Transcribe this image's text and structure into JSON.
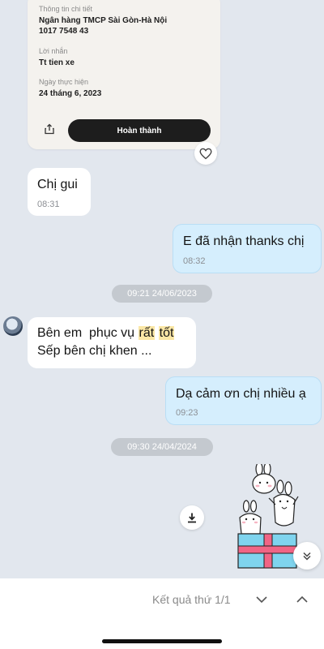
{
  "receipt": {
    "section_label": "Thông tin chi tiết",
    "bank_name": "Ngân hàng TMCP Sài Gòn-Hà Nội",
    "account_number": "1017 7548 43",
    "message_label": "Lời nhắn",
    "message_value": "Tt tien xe",
    "date_label": "Ngày thực hiện",
    "date_value": "24 tháng 6, 2023",
    "done_button": "Hoàn thành",
    "share_icon": "share-icon",
    "heart_icon": "heart-icon"
  },
  "messages": [
    {
      "direction": "incoming",
      "text": "Chị gui",
      "time": "08:31"
    },
    {
      "direction": "outgoing",
      "text": "E đã nhận thanks chị",
      "time": "08:32"
    },
    {
      "direction": "incoming",
      "line1_prefix": "Bên em  phục vụ ",
      "highlight1": "rất",
      "space": " ",
      "highlight2": "tốt",
      "line2": "Sếp bên chị khen ..."
    },
    {
      "direction": "outgoing",
      "text": "Dạ cảm ơn chị nhiều ạ",
      "time": "09:23"
    }
  ],
  "date_separators": [
    "09:21 24/06/2023",
    "09:30 24/04/2024"
  ],
  "sticker": {
    "name": "bunny-gift-sticker"
  },
  "search_bar": {
    "result_text": "Kết quả thứ 1/1",
    "prev_icon": "chevron-down-icon",
    "next_icon": "chevron-up-icon"
  },
  "colors": {
    "background": "#e2e7ee",
    "outgoing_bubble": "#d5eefd",
    "incoming_bubble": "#ffffff",
    "highlight": "#fbe7a6",
    "done_button": "#1d1d1d"
  }
}
